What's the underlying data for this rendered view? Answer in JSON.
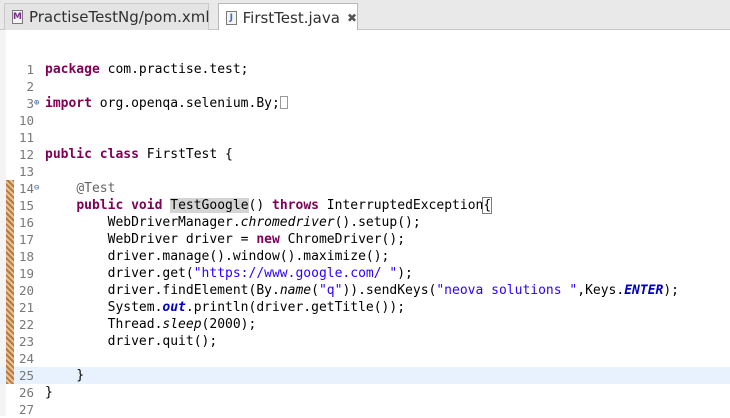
{
  "tabs": [
    {
      "label": "PractiseTestNg/pom.xml",
      "icon": "M",
      "active": false
    },
    {
      "label": "FirstTest.java",
      "icon": "J",
      "active": true,
      "close": "✖"
    }
  ],
  "lines": [
    {
      "num": "1",
      "code": [
        {
          "t": "package",
          "c": "kw"
        },
        {
          "t": " com.practise.test;"
        }
      ]
    },
    {
      "num": "2",
      "code": []
    },
    {
      "num": "3",
      "fold": "plus",
      "code": [
        {
          "t": "import",
          "c": "kw"
        },
        {
          "t": " org.openqa.selenium.By;"
        },
        {
          "t": "",
          "c": "box"
        }
      ]
    },
    {
      "num": "10",
      "code": []
    },
    {
      "num": "11",
      "code": []
    },
    {
      "num": "12",
      "code": [
        {
          "t": "public",
          "c": "kw"
        },
        {
          "t": " "
        },
        {
          "t": "class",
          "c": "kw"
        },
        {
          "t": " FirstTest {"
        }
      ]
    },
    {
      "num": "13",
      "code": []
    },
    {
      "num": "14",
      "fold": "minus",
      "changed": true,
      "code": [
        {
          "t": "    "
        },
        {
          "t": "@Test",
          "c": "ann"
        }
      ]
    },
    {
      "num": "15",
      "changed": true,
      "code": [
        {
          "t": "    "
        },
        {
          "t": "public",
          "c": "kw"
        },
        {
          "t": " "
        },
        {
          "t": "void",
          "c": "kw"
        },
        {
          "t": " "
        },
        {
          "t": "TestGoogle",
          "c": "occ"
        },
        {
          "t": "() "
        },
        {
          "t": "throws",
          "c": "kw"
        },
        {
          "t": " InterruptedException"
        },
        {
          "t": "{",
          "c": "bm"
        }
      ]
    },
    {
      "num": "16",
      "changed": true,
      "code": [
        {
          "t": "        WebDriverManager."
        },
        {
          "t": "chromedriver",
          "c": "it"
        },
        {
          "t": "().setup();"
        }
      ]
    },
    {
      "num": "17",
      "changed": true,
      "code": [
        {
          "t": "        WebDriver driver = "
        },
        {
          "t": "new",
          "c": "kw"
        },
        {
          "t": " ChromeDriver();"
        }
      ]
    },
    {
      "num": "18",
      "changed": true,
      "code": [
        {
          "t": "        driver.manage().window().maximize();"
        }
      ]
    },
    {
      "num": "19",
      "changed": true,
      "code": [
        {
          "t": "        driver.get("
        },
        {
          "t": "\"https://www.google.com/ \"",
          "c": "str"
        },
        {
          "t": ");"
        }
      ]
    },
    {
      "num": "20",
      "changed": true,
      "code": [
        {
          "t": "        driver.findElement(By."
        },
        {
          "t": "name",
          "c": "it"
        },
        {
          "t": "("
        },
        {
          "t": "\"q\"",
          "c": "str"
        },
        {
          "t": ")).sendKeys("
        },
        {
          "t": "\"neova solutions \"",
          "c": "str"
        },
        {
          "t": ",Keys."
        },
        {
          "t": "ENTER",
          "c": "fld it kw"
        },
        {
          "t": ");"
        }
      ]
    },
    {
      "num": "21",
      "changed": true,
      "code": [
        {
          "t": "        System."
        },
        {
          "t": "out",
          "c": "fld it kw"
        },
        {
          "t": ".println(driver.getTitle());"
        }
      ]
    },
    {
      "num": "22",
      "changed": true,
      "code": [
        {
          "t": "        Thread."
        },
        {
          "t": "sleep",
          "c": "it"
        },
        {
          "t": "(2000);"
        }
      ]
    },
    {
      "num": "23",
      "changed": true,
      "code": [
        {
          "t": "        driver.quit();"
        }
      ]
    },
    {
      "num": "24",
      "changed": true,
      "code": []
    },
    {
      "num": "25",
      "changed": true,
      "current": true,
      "code": [
        {
          "t": "    }"
        }
      ]
    },
    {
      "num": "26",
      "code": [
        {
          "t": "}"
        }
      ]
    },
    {
      "num": "27",
      "code": []
    }
  ]
}
